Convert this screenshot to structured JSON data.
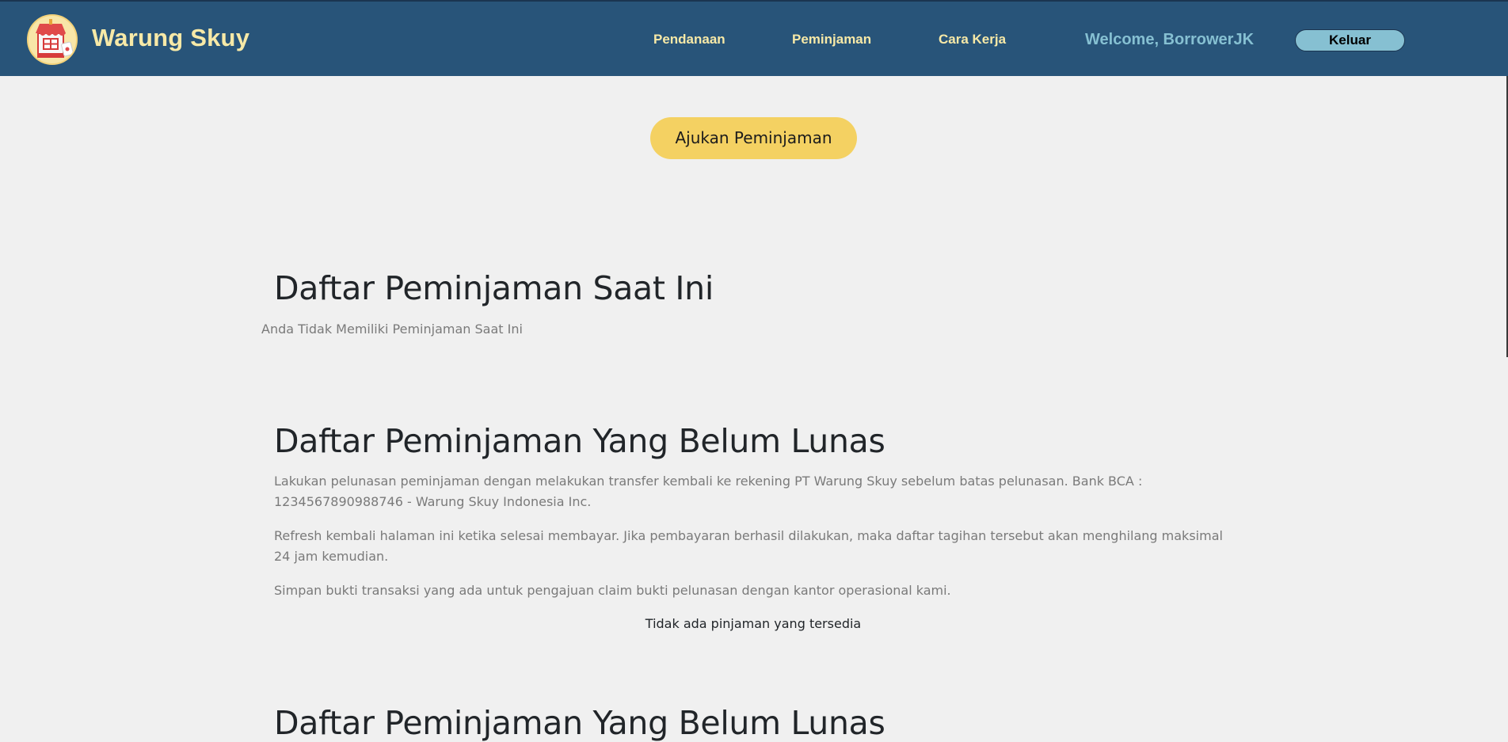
{
  "navbar": {
    "brand": "Warung Skuy",
    "links": [
      "Pendanaan",
      "Peminjaman",
      "Cara Kerja"
    ],
    "welcome": "Welcome, BorrowerJK",
    "logout_label": "Keluar"
  },
  "actions": {
    "submit_loan_label": "Ajukan Peminjaman"
  },
  "current_loans": {
    "title": "Daftar Peminjaman Saat Ini",
    "empty_text": "Anda Tidak Memiliki Peminjaman Saat Ini"
  },
  "unpaid_loans": {
    "title": "Daftar Peminjaman Yang Belum Lunas",
    "paragraphs": [
      "Lakukan pelunasan peminjaman dengan melakukan transfer kembali ke rekening PT Warung Skuy sebelum batas pelunasan. Bank BCA : 1234567890988746 - Warung Skuy Indonesia Inc.",
      "Refresh kembali halaman ini ketika selesai membayar. Jika pembayaran berhasil dilakukan, maka daftar tagihan tersebut akan menghilang maksimal 24 jam kemudian.",
      "Simpan bukti transaksi yang ada untuk pengajuan claim bukti pelunasan dengan kantor operasional kami."
    ],
    "empty_text": "Tidak ada pinjaman yang tersedia"
  },
  "next_section": {
    "title": "Daftar Peminjaman Yang Belum Lunas"
  },
  "colors": {
    "navbar_bg": "#285479",
    "brand": "#f7e9a7",
    "welcome": "#86c0d2",
    "submit_button": "#f4d162",
    "page_bg": "#f0f0f0"
  },
  "icons": {
    "logo": "storefront-icon"
  }
}
